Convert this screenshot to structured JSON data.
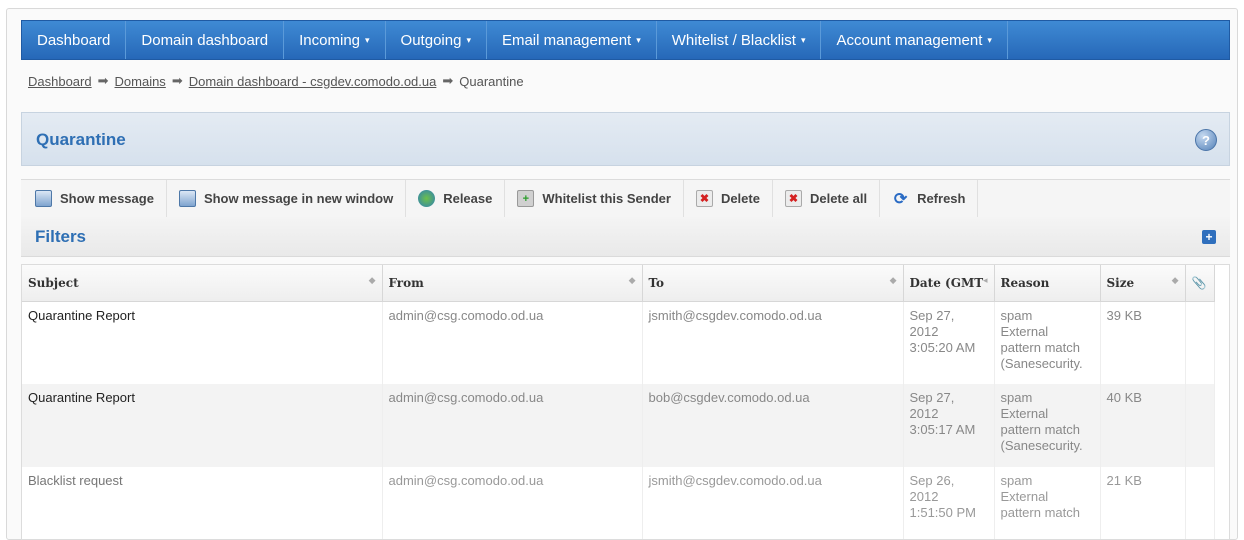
{
  "nav": {
    "items": [
      {
        "label": "Dashboard",
        "caret": ""
      },
      {
        "label": "Domain dashboard",
        "caret": ""
      },
      {
        "label": "Incoming",
        "caret": "▾"
      },
      {
        "label": "Outgoing",
        "caret": "▾"
      },
      {
        "label": "Email management",
        "caret": "▾"
      },
      {
        "label": "Whitelist / Blacklist",
        "caret": "▾"
      },
      {
        "label": "Account management",
        "caret": "▾"
      }
    ]
  },
  "breadcrumb": {
    "items": [
      "Dashboard",
      "Domains",
      "Domain dashboard - csgdev.comodo.od.ua",
      "Quarantine"
    ],
    "separator": "➡"
  },
  "panel": {
    "title": "Quarantine",
    "help": "?"
  },
  "toolbar": {
    "buttons": [
      {
        "label": "Show message",
        "icon": "message-icon"
      },
      {
        "label": "Show message in new window",
        "icon": "new-window-icon"
      },
      {
        "label": "Release",
        "icon": "release-icon"
      },
      {
        "label": "Whitelist this Sender",
        "icon": "whitelist-icon"
      },
      {
        "label": "Delete",
        "icon": "delete-icon"
      },
      {
        "label": "Delete all",
        "icon": "delete-all-icon"
      },
      {
        "label": "Refresh",
        "icon": "refresh-icon"
      }
    ]
  },
  "filters": {
    "title": "Filters",
    "expand": "+"
  },
  "table": {
    "columns": [
      "Subject",
      "From",
      "To",
      "Date (GMT",
      "Reason",
      "Size",
      ""
    ],
    "rows": [
      {
        "subject": "Quarantine Report",
        "from": "admin@csg.comodo.od.ua",
        "to": "jsmith@csgdev.comodo.od.ua",
        "date": [
          "Sep 27,",
          "2012",
          "3:05:20 AM"
        ],
        "reason": [
          "spam",
          "External",
          "pattern match",
          "(Sanesecurity."
        ],
        "size": "39 KB"
      },
      {
        "subject": "Quarantine Report",
        "from": "admin@csg.comodo.od.ua",
        "to": "bob@csgdev.comodo.od.ua",
        "date": [
          "Sep 27,",
          "2012",
          "3:05:17 AM"
        ],
        "reason": [
          "spam",
          "External",
          "pattern match",
          "(Sanesecurity."
        ],
        "size": "40 KB"
      },
      {
        "subject": "Blacklist request",
        "from": "admin@csg.comodo.od.ua",
        "to": "jsmith@csgdev.comodo.od.ua",
        "date": [
          "Sep 26,",
          "2012",
          "1:51:50 PM"
        ],
        "reason": [
          "spam",
          "External",
          "pattern match"
        ],
        "size": "21 KB"
      }
    ]
  }
}
